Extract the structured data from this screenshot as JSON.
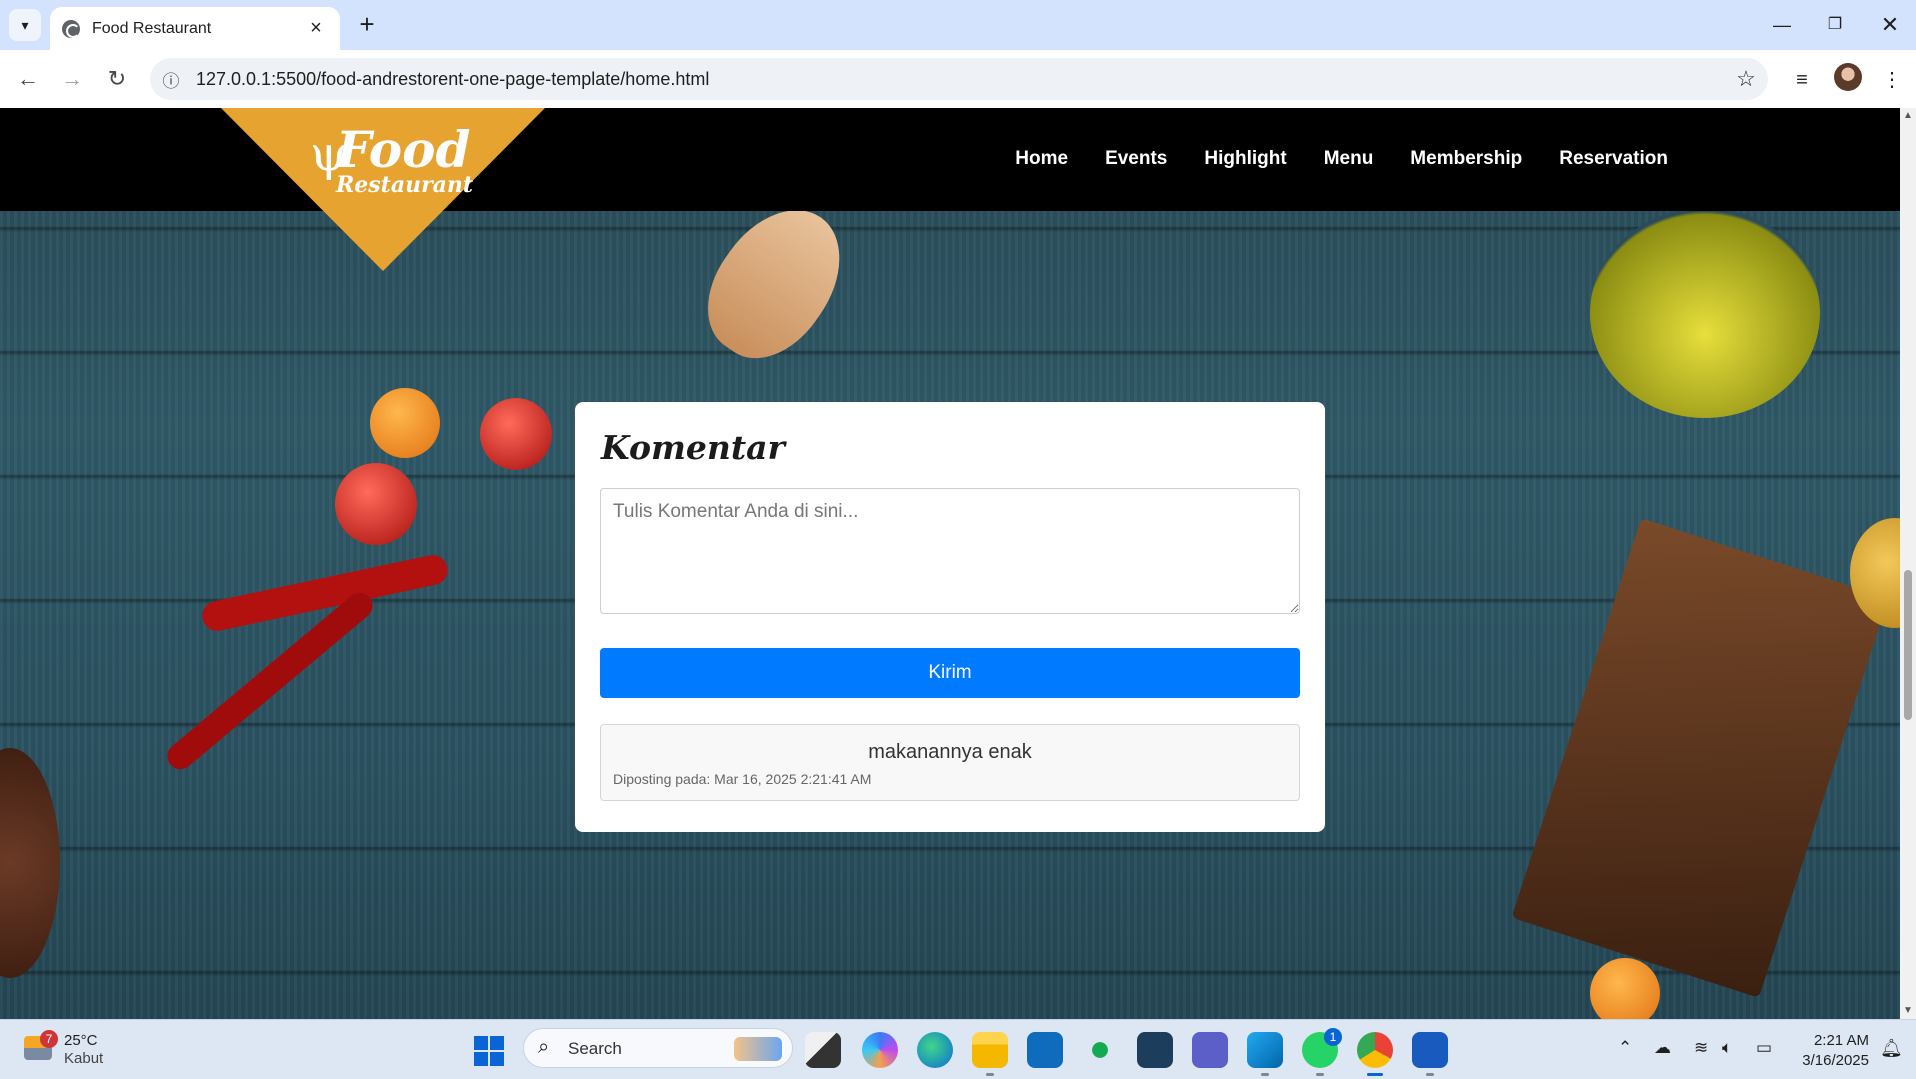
{
  "browser": {
    "tab_title": "Food Restaurant",
    "url": "127.0.0.1:5500/food-andrestorent-one-page-template/home.html"
  },
  "site": {
    "logo": {
      "line1": "Food",
      "line2": "Restaurant"
    },
    "nav": [
      "Home",
      "Events",
      "Highlight",
      "Menu",
      "Membership",
      "Reservation"
    ]
  },
  "comment_card": {
    "title": "Komentar",
    "textarea_placeholder": "Tulis Komentar Anda di sini...",
    "textarea_value": "",
    "submit_label": "Kirim",
    "comments": [
      {
        "text": "makanannya enak",
        "posted": "Diposting pada: Mar 16, 2025 2:21:41 AM"
      }
    ]
  },
  "taskbar": {
    "weather_temp": "25°C",
    "weather_desc": "Kabut",
    "weather_badge": "7",
    "search_label": "Search",
    "whatsapp_badge": "1",
    "time": "2:21 AM",
    "date": "3/16/2025"
  },
  "colors": {
    "accent_button": "#007bff",
    "logo_orange": "#e7a32f",
    "header_black": "#000000"
  }
}
